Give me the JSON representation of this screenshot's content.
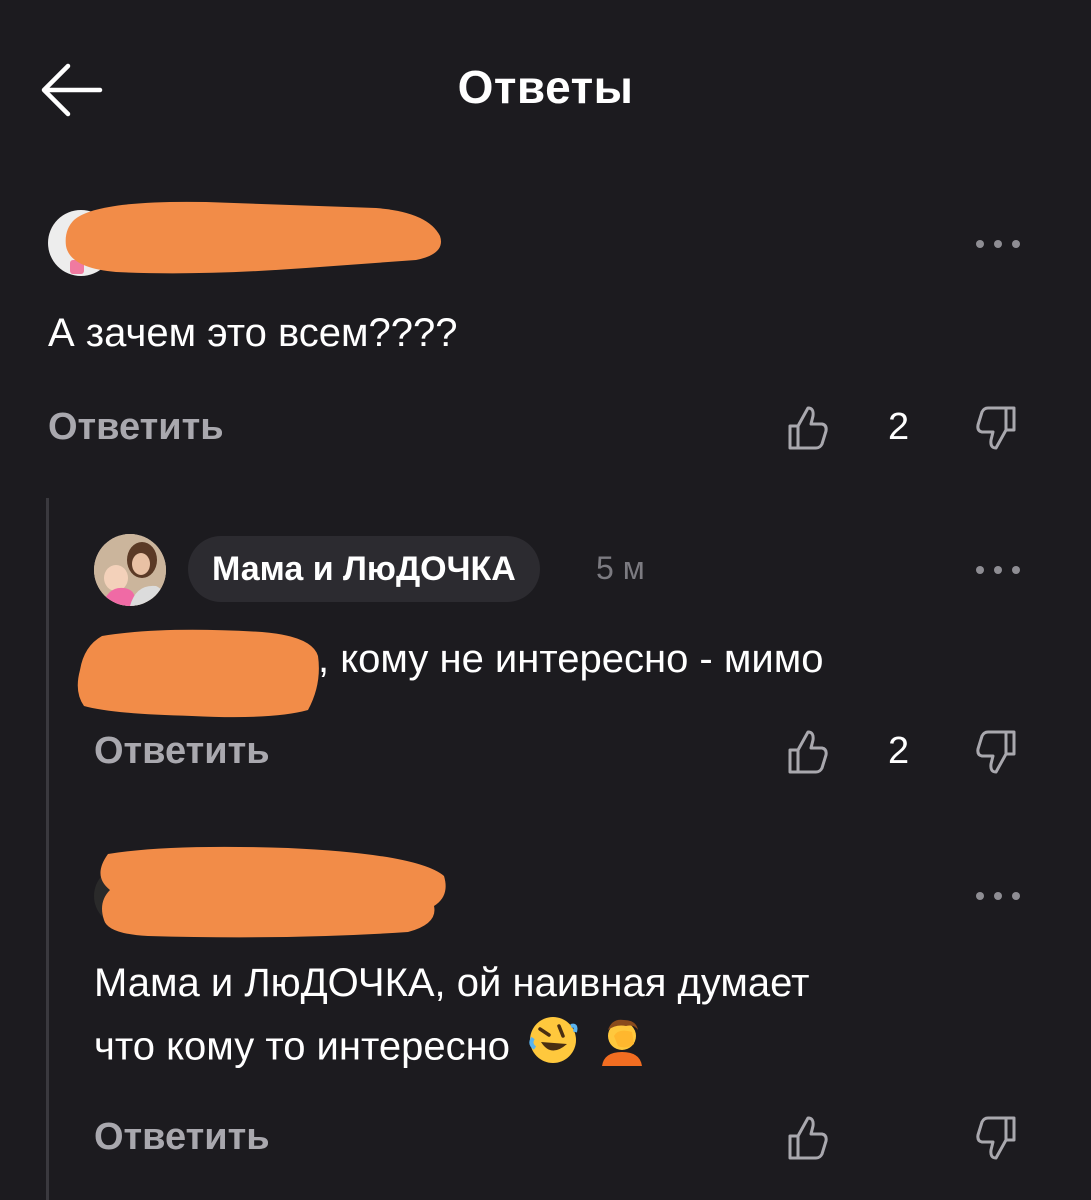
{
  "header": {
    "title": "Ответы",
    "back_icon": "arrow-left-icon"
  },
  "colors": {
    "background": "#1c1b1f",
    "text_primary": "#ffffff",
    "text_secondary": "#a9a8ae",
    "redaction": "#f28c48",
    "pill_background": "#2c2b30"
  },
  "comments": [
    {
      "author_redacted": true,
      "text": "А зачем это всем????",
      "reply_label": "Ответить",
      "likes": "2"
    },
    {
      "author": "Мама и ЛюДОЧКА",
      "time": "5 м",
      "text_suffix": ", кому не интересно - мимо",
      "reply_label": "Ответить",
      "likes": "2"
    },
    {
      "author_redacted": true,
      "text_line1": "Мама и ЛюДОЧКА, ой наивная думает",
      "text_line2": "что кому то интересно",
      "emojis": [
        "rolling-on-floor-laughing-emoji",
        "facepalm-emoji"
      ],
      "reply_label": "Ответить"
    }
  ]
}
